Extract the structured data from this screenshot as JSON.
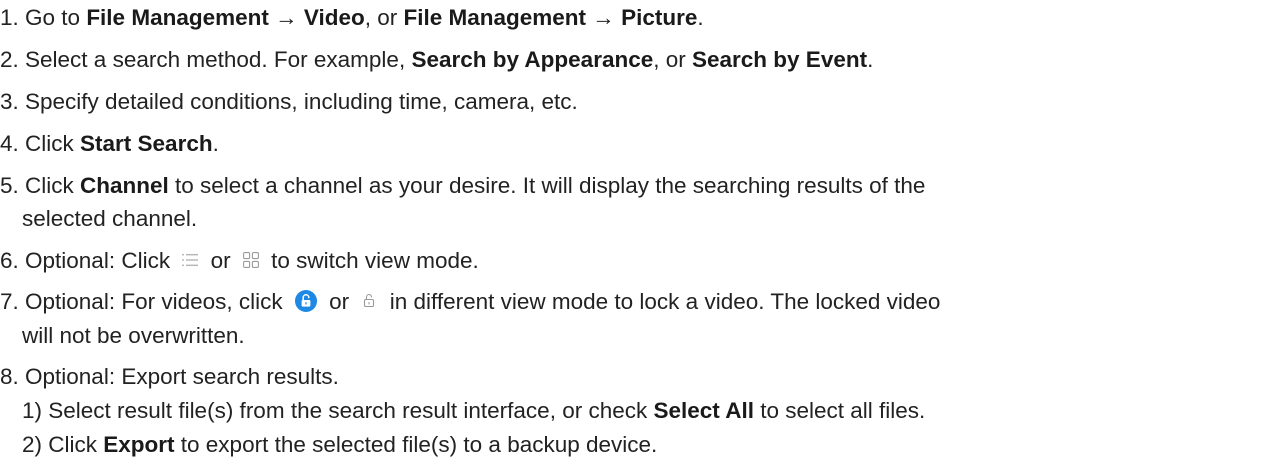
{
  "steps": {
    "s1": {
      "a": "1. Go to ",
      "b1": "File Management",
      "c": " → ",
      "b2": "Video",
      "d": ", or ",
      "b3": "File Management",
      "e": " → ",
      "b4": "Picture",
      "f": "."
    },
    "s2": {
      "a": "2. Select a search method. For example, ",
      "b1": "Search by Appearance",
      "c": ", or ",
      "b2": "Search by Event",
      "d": "."
    },
    "s3": {
      "a": "3. Specify detailed conditions, including time, camera, etc."
    },
    "s4": {
      "a": "4. Click ",
      "b1": "Start Search",
      "c": "."
    },
    "s5": {
      "a": "5. Click ",
      "b1": "Channel",
      "c": " to select a channel as your desire. It will display the searching results of the",
      "line2": "selected channel."
    },
    "s6": {
      "a": "6. Optional: Click",
      "or": "or",
      "c": "to switch view mode.",
      "icon1": "list-view-icon",
      "icon2": "grid-view-icon"
    },
    "s7": {
      "a": "7. Optional: For videos, click",
      "or": "or",
      "c": "in different view mode to lock a video. The locked video",
      "line2": "will not be overwritten.",
      "icon1": "unlock-blue-icon",
      "icon2": "unlock-gray-icon"
    },
    "s8": {
      "a": "8. Optional: Export search results."
    },
    "s8_1": {
      "a": "1) Select result file(s) from the search result interface, or check ",
      "b1": "Select All",
      "c": " to select all files."
    },
    "s8_2": {
      "a": "2) Click ",
      "b1": "Export",
      "c": " to export the selected file(s) to a backup device."
    }
  },
  "colors": {
    "text": "#222222",
    "accent": "#1e88e5",
    "icon_gray": "#9a9a9a"
  }
}
